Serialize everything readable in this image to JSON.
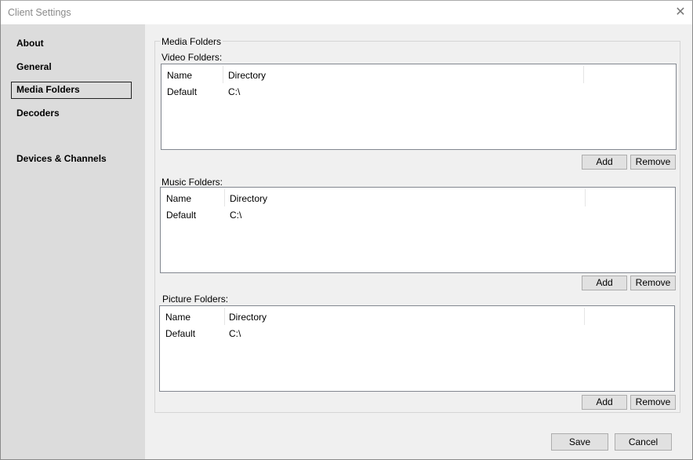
{
  "window": {
    "title": "Client Settings",
    "close_icon": "close-icon"
  },
  "sidebar": {
    "items": [
      {
        "label": "About",
        "active": false
      },
      {
        "label": "General",
        "active": false
      },
      {
        "label": "Media Folders",
        "active": true
      },
      {
        "label": "Decoders",
        "active": false
      },
      {
        "label": "Devices & Channels",
        "active": false
      }
    ]
  },
  "media_folders": {
    "group_title": "Media Folders",
    "video": {
      "label": "Video Folders:",
      "columns": [
        "Name",
        "Directory"
      ],
      "rows": [
        {
          "name": "Default",
          "directory": "C:\\"
        }
      ],
      "add_label": "Add",
      "remove_label": "Remove"
    },
    "music": {
      "label": "Music Folders:",
      "columns": [
        "Name",
        "Directory"
      ],
      "rows": [
        {
          "name": "Default",
          "directory": "C:\\"
        }
      ],
      "add_label": "Add",
      "remove_label": "Remove"
    },
    "picture": {
      "label": "Picture Folders:",
      "columns": [
        "Name",
        "Directory"
      ],
      "rows": [
        {
          "name": "Default",
          "directory": "C:\\"
        }
      ],
      "add_label": "Add",
      "remove_label": "Remove"
    }
  },
  "footer": {
    "save_label": "Save",
    "cancel_label": "Cancel"
  }
}
